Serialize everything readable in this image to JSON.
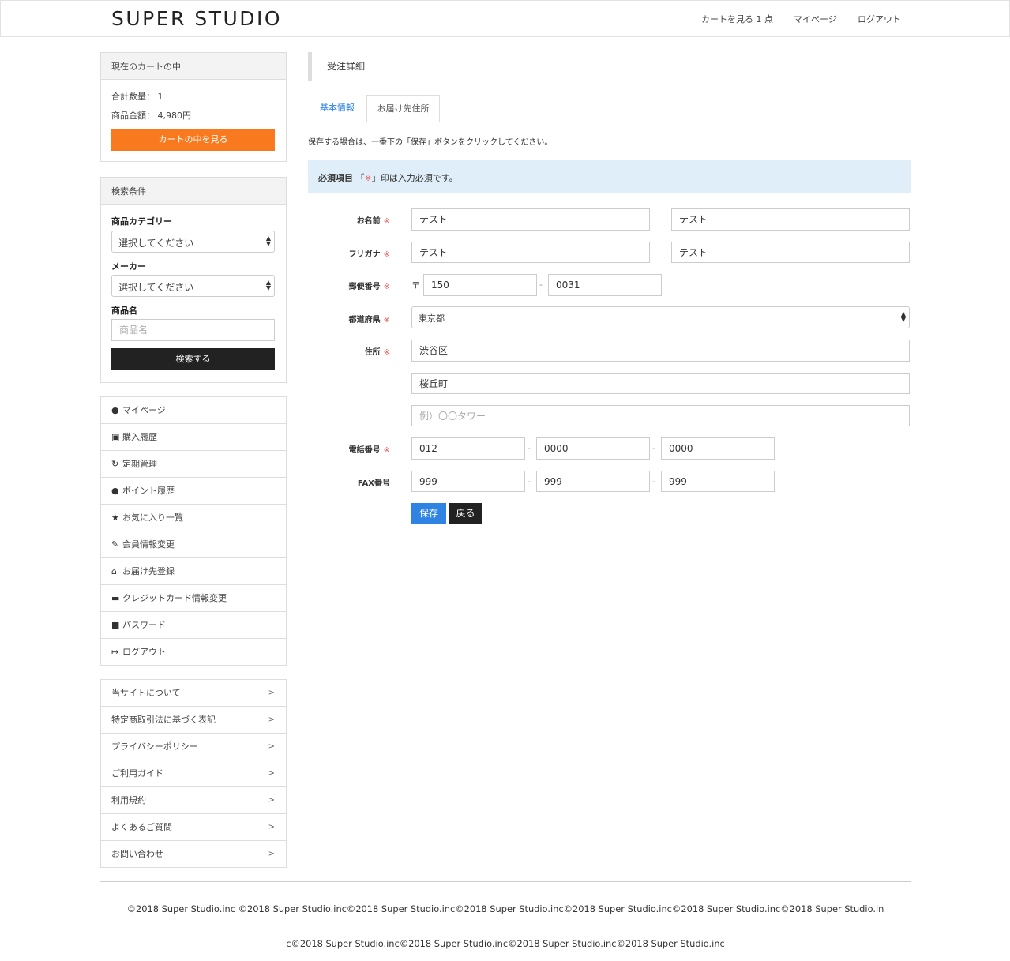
{
  "header": {
    "logo": "SUPER STUDIO",
    "nav": [
      "カートを見る 1 点",
      "マイページ",
      "ログアウト"
    ]
  },
  "cart_box": {
    "title": "現在のカートの中",
    "quantity": "合計数量： 1",
    "amount": "商品金額： 4,980円",
    "button": "カートの中を見る"
  },
  "search_box": {
    "title": "検索条件",
    "category_label": "商品カテゴリー",
    "category_value": "選択してください",
    "maker_label": "メーカー",
    "maker_value": "選択してください",
    "name_label": "商品名",
    "name_placeholder": "商品名",
    "button": "検索する"
  },
  "member_menu": [
    {
      "icon": "user-icon",
      "label": "マイページ"
    },
    {
      "icon": "cart-icon",
      "label": "購入履歴"
    },
    {
      "icon": "refresh-icon",
      "label": "定期管理"
    },
    {
      "icon": "piggy-bank-icon",
      "label": "ポイント履歴"
    },
    {
      "icon": "star-icon",
      "label": "お気に入り一覧"
    },
    {
      "icon": "pencil-icon",
      "label": "会員情報変更"
    },
    {
      "icon": "home-icon",
      "label": "お届け先登録"
    },
    {
      "icon": "credit-card-icon",
      "label": "クレジットカード情報変更"
    },
    {
      "icon": "lock-icon",
      "label": "パスワード"
    },
    {
      "icon": "logout-icon",
      "label": "ログアウト"
    }
  ],
  "info_menu": [
    {
      "label": "当サイトについて",
      "chevron": ">"
    },
    {
      "label": "特定商取引法に基づく表記",
      "chevron": ">"
    },
    {
      "label": "プライバシーポリシー",
      "chevron": ">"
    },
    {
      "label": "ご利用ガイド",
      "chevron": ">"
    },
    {
      "label": "利用規約",
      "chevron": ">"
    },
    {
      "label": "よくあるご質問",
      "chevron": ">"
    },
    {
      "label": "お問い合わせ",
      "chevron": ">"
    }
  ],
  "main": {
    "title": "受注詳細",
    "tabs": [
      "基本情報",
      "お届け先住所"
    ],
    "active_tab": "お届け先住所",
    "instruction": "保存する場合は、一番下の「保存」ボタンをクリックしてください。",
    "notice_bold": "必須項目",
    "notice_open": "「",
    "notice_mark": "※",
    "notice_rest": "」印は入力必須です。"
  },
  "form": {
    "required_mark": "※",
    "name_label": "お名前",
    "name_last": "テスト",
    "name_first": "テスト",
    "kana_label": "フリガナ",
    "kana_last": "テスト",
    "kana_first": "テスト",
    "zip_label": "郵便番号",
    "zip_symbol": "〒",
    "zip1": "150",
    "zip2": "0031",
    "pref_label": "都道府県",
    "pref_value": "東京都",
    "addr_label": "住所",
    "addr1": "渋谷区",
    "addr2": "桜丘町",
    "addr3_placeholder": "例）〇〇タワー",
    "tel_label": "電話番号",
    "tel1": "012",
    "tel2": "0000",
    "tel3": "0000",
    "fax_label": "FAX番号",
    "fax1": "999",
    "fax2": "999",
    "fax3": "999",
    "separator": "-",
    "save_button": "保存",
    "back_button": "戻る"
  },
  "footer": {
    "text": "©2018 Super Studio.inc ©2018 Super Studio.inc©2018 Super Studio.inc©2018 Super Studio.inc©2018 Super Studio.inc©2018 Super Studio.inc©2018 Super Studio.inc©2018 Super Studio.inc©2018 Super Studio.inc©2018 Super Studio.inc©2018 Super Studio.inc"
  },
  "colors": {
    "accent_orange": "#f97a1e",
    "primary_blue": "#2e83e3",
    "notice_bg": "#dfeef8",
    "required_red": "#e55555"
  }
}
